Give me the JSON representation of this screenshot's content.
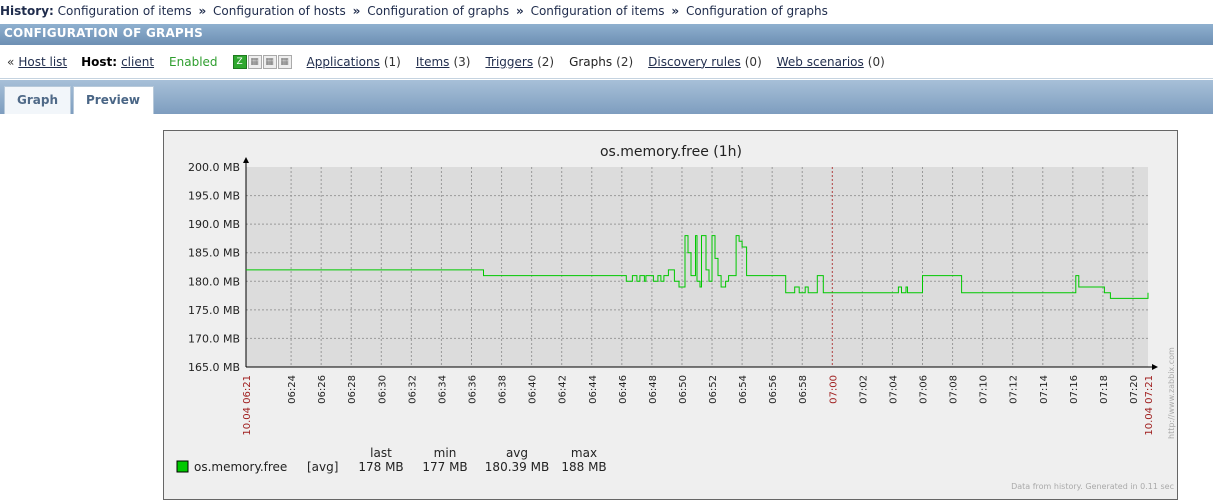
{
  "history": {
    "label": "History:",
    "items": [
      "Configuration of items",
      "Configuration of hosts",
      "Configuration of graphs",
      "Configuration of items",
      "Configuration of graphs"
    ],
    "separator": "»"
  },
  "header": {
    "title": "CONFIGURATION OF GRAPHS"
  },
  "host_nav": {
    "back_arrow": "«",
    "host_list": "Host list",
    "host_label": "Host:",
    "host_name": "client",
    "status": "Enabled",
    "availability": [
      {
        "name": "Z",
        "icon": "zabbix-agent-icon",
        "active": true
      },
      {
        "name": "SNMP",
        "icon": "snmp-icon",
        "active": false
      },
      {
        "name": "JMX",
        "icon": "jmx-icon",
        "active": false
      },
      {
        "name": "IPMI",
        "icon": "ipmi-icon",
        "active": false
      }
    ],
    "links": [
      {
        "label": "Applications",
        "count": "(1)"
      },
      {
        "label": "Items",
        "count": "(3)"
      },
      {
        "label": "Triggers",
        "count": "(2)"
      }
    ],
    "graphs": {
      "label": "Graphs",
      "count": "(2)"
    },
    "links2": [
      {
        "label": "Discovery rules",
        "count": "(0)"
      },
      {
        "label": "Web scenarios",
        "count": "(0)"
      }
    ]
  },
  "tabs": [
    {
      "label": "Graph"
    },
    {
      "label": "Preview"
    }
  ],
  "chart_data": {
    "type": "line",
    "title": "os.memory.free (1h)",
    "ylim": [
      165,
      200
    ],
    "y_ticks": [
      "165.0 MB",
      "170.0 MB",
      "175.0 MB",
      "180.0 MB",
      "185.0 MB",
      "190.0 MB",
      "195.0 MB",
      "200.0 MB"
    ],
    "x_ticks": [
      "10.04 06:21",
      "06:24",
      "06:26",
      "06:28",
      "06:30",
      "06:32",
      "06:34",
      "06:36",
      "06:38",
      "06:40",
      "06:42",
      "06:44",
      "06:46",
      "06:48",
      "06:50",
      "06:52",
      "06:54",
      "06:56",
      "06:58",
      "07:00",
      "07:02",
      "07:04",
      "07:06",
      "07:08",
      "07:10",
      "07:12",
      "07:14",
      "07:16",
      "07:18",
      "07:20",
      "10.04 07:21"
    ],
    "x_tick_red": [
      "10.04 06:21",
      "07:00",
      "10.04 07:21"
    ],
    "grid": true,
    "series": [
      {
        "name": "os.memory.free",
        "color": "#00c800",
        "x": [
          "06:21",
          "06:36.7",
          "06:36.8",
          "06:46.2",
          "06:46.3",
          "06:46.6",
          "06:46.7",
          "06:47.0",
          "06:47.2",
          "06:47.5",
          "06:47.6",
          "06:48.1",
          "06:48.4",
          "06:48.6",
          "06:48.8",
          "06:49.0",
          "06:49.1",
          "06:49.3",
          "06:49.5",
          "06:49.8",
          "06:50.2",
          "06:50.4",
          "06:50.6",
          "06:50.9",
          "06:51.0",
          "06:51.2",
          "06:51.3",
          "06:51.6",
          "06:51.8",
          "06:52.0",
          "06:52.2",
          "06:52.4",
          "06:52.6",
          "06:52.9",
          "06:53.1",
          "06:53.6",
          "06:53.8",
          "06:54.0",
          "06:54.3",
          "06:56.8",
          "06:56.9",
          "06:57.4",
          "06:57.5",
          "06:57.8",
          "06:58.2",
          "06:58.4",
          "06:58.7",
          "06:59.0",
          "06:59.4",
          "06:59.6",
          "07:04.2",
          "07:04.4",
          "07:04.6",
          "07:04.9",
          "07:05.0",
          "07:05.9",
          "07:06.0",
          "07:08.5",
          "07:08.6",
          "07:16.0",
          "07:16.2",
          "07:16.4",
          "07:18.1",
          "07:18.3",
          "07:18.5",
          "07:21"
        ],
        "y": [
          182,
          182,
          181,
          181,
          180,
          180,
          181,
          180,
          181,
          180,
          181,
          180,
          181,
          180,
          181,
          181,
          182,
          182,
          180,
          179,
          188,
          185,
          181,
          188,
          180,
          179,
          188,
          182,
          180,
          188,
          184,
          181,
          179,
          180,
          181,
          188,
          187,
          186,
          181,
          181,
          178,
          178,
          179,
          178,
          179,
          178,
          178,
          181,
          178,
          178,
          178,
          179,
          178,
          179,
          178,
          178,
          181,
          181,
          178,
          178,
          181,
          179,
          178,
          178,
          177,
          178
        ]
      }
    ],
    "legend": {
      "headers": [
        "last",
        "min",
        "avg",
        "max"
      ],
      "name": "os.memory.free",
      "func": "[avg]",
      "values": [
        "178 MB",
        "177 MB",
        "180.39 MB",
        "188 MB"
      ],
      "color": "#00c800"
    },
    "watermark": "http://www.zabbix.com",
    "footer": "Data from history. Generated in 0.11 sec"
  }
}
